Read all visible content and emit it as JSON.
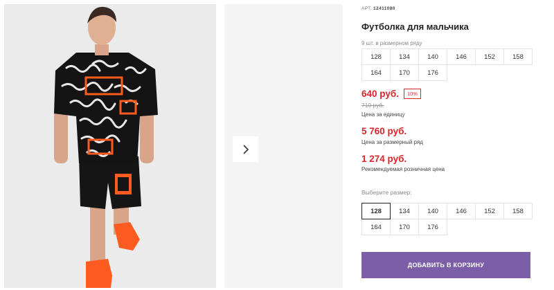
{
  "product": {
    "sku_label": "АРТ.",
    "sku": "12411080",
    "title": "Футболка для мальчика",
    "pack_label": "9 шт. в размерном ряду",
    "pack_sizes": [
      "128",
      "134",
      "140",
      "146",
      "152",
      "158",
      "164",
      "170",
      "176"
    ]
  },
  "pricing": {
    "price": "640 руб.",
    "discount": "10%",
    "old_price": "710 руб.",
    "unit_label": "Цена за единицу",
    "pack_price": "5 760 руб.",
    "pack_price_label": "Цена за размерный ряд",
    "rrp": "1 274 руб.",
    "rrp_label": "Рекомендуемая розничная цена"
  },
  "size_selector": {
    "label": "Выберите размер:",
    "sizes": [
      "128",
      "134",
      "140",
      "146",
      "152",
      "158",
      "164",
      "170",
      "176"
    ],
    "selected": "128"
  },
  "cart": {
    "button_label": "ДОБАВИТЬ В КОРЗИНУ"
  },
  "gallery": {
    "next_icon": "chevron-right-icon"
  },
  "colors": {
    "price": "#d9262b",
    "button": "#7b5ea7",
    "accent_orange": "#ff5a1f"
  }
}
